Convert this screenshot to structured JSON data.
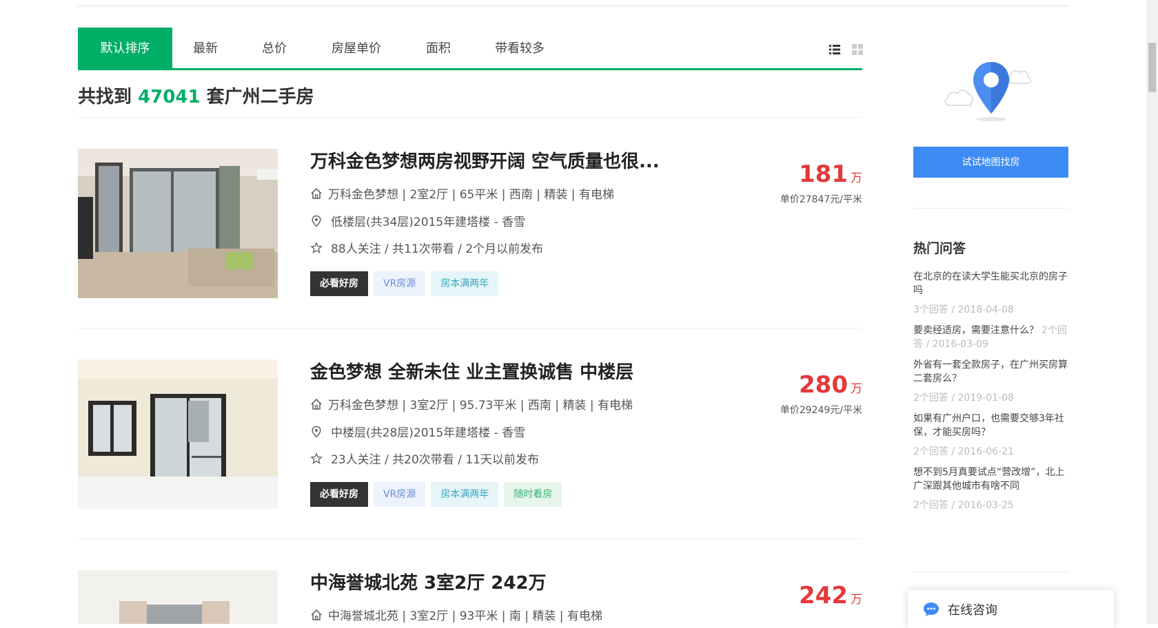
{
  "sort": {
    "tabs": [
      "默认排序",
      "最新",
      "总价",
      "房屋单价",
      "面积",
      "带看较多"
    ],
    "active": 0
  },
  "summary": {
    "prefix": "共找到",
    "count": "47041",
    "suffix": "套广州二手房"
  },
  "listings": [
    {
      "title": "万科金色梦想两房视野开阔 空气质量也很...",
      "house_info": "万科金色梦想 | 2室2厅 | 65平米 | 西南 | 精装 | 有电梯",
      "position_info": "低楼层(共34层)2015年建塔楼 - 香雪",
      "follow_info": "88人关注 / 共11次带看 / 2个月以前发布",
      "tags": [
        "必看好房",
        "VR房源",
        "房本满两年"
      ],
      "price": "181",
      "price_unit": "万",
      "unit_price": "单价27847元/平米"
    },
    {
      "title": "金色梦想 全新未住 业主置换诚售 中楼层",
      "house_info": "万科金色梦想 | 3室2厅 | 95.73平米 | 西南 | 精装 | 有电梯",
      "position_info": "中楼层(共28层)2015年建塔楼 - 香雪",
      "follow_info": "23人关注 / 共20次带看 / 11天以前发布",
      "tags": [
        "必看好房",
        "VR房源",
        "房本满两年",
        "随时看房"
      ],
      "price": "280",
      "price_unit": "万",
      "unit_price": "单价29249元/平米"
    },
    {
      "title": "中海誉城北苑 3室2厅 242万",
      "house_info": "中海誉城北苑 | 3室2厅 | 93平米 | 南 | 精装 | 有电梯",
      "price": "242",
      "price_unit": "万"
    }
  ],
  "sidebar": {
    "map_button": "试试地图找房",
    "hot_title": "热门问答",
    "qa": [
      {
        "q": "在北京的在读大学生能买北京的房子吗",
        "meta": "3个回答 / 2018-04-08"
      },
      {
        "q": "要卖经适房，需要注意什么？",
        "meta": "2个回答 / 2016-03-09"
      },
      {
        "q": "外省有一套全款房子，在广州买房算二套房么？",
        "meta": "2个回答 / 2019-01-08"
      },
      {
        "q": "如果有广州户口，也需要交够3年社保，才能买房吗？",
        "meta": "2个回答 / 2016-06-21"
      },
      {
        "q": "想不到5月真要试点“营改增”，北上广深跟其他城市有啥不同",
        "meta": "2个回答 / 2016-03-25"
      }
    ]
  },
  "consult": {
    "label": "在线咨询"
  },
  "colors": {
    "accent": "#00ae66",
    "price": "#e4393c",
    "map_button": "#3d8bf5"
  }
}
